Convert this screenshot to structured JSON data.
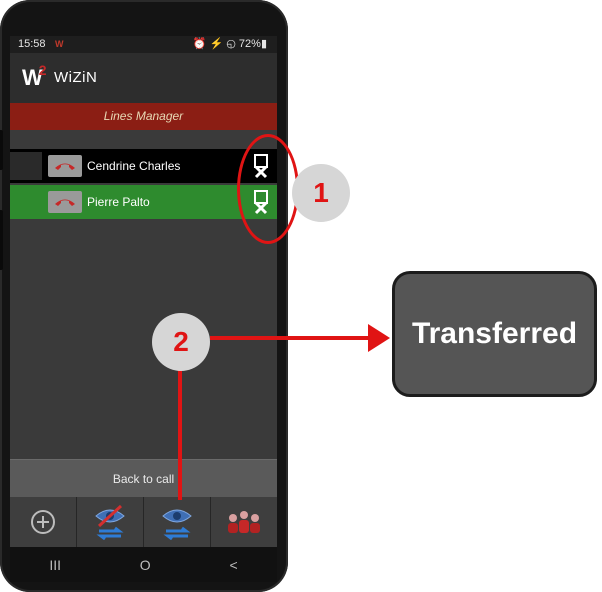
{
  "status": {
    "time": "15:58",
    "app_indicator": "W",
    "right": "⏰ ⚡ ◵ 72%▮"
  },
  "app": {
    "logo": "W",
    "logo_sup": "2",
    "name": "WiZiN"
  },
  "title": "Lines Manager",
  "lines": [
    {
      "name": "Cendrine Charles",
      "bg": "#000000"
    },
    {
      "name": "Pierre Palto",
      "bg": "#2e8b2e"
    }
  ],
  "back_to_call": "Back to call",
  "tabs": [
    "add-icon",
    "hide-transfer-icon",
    "transfer-icon",
    "conference-icon"
  ],
  "nav": [
    "III",
    "O",
    "<"
  ],
  "annotations": {
    "marker1": "1",
    "marker2": "2",
    "result": "Transferred"
  },
  "colors": {
    "accent": "#e01414",
    "title_bar": "#8b1e14",
    "active_line": "#2e8b2e"
  }
}
